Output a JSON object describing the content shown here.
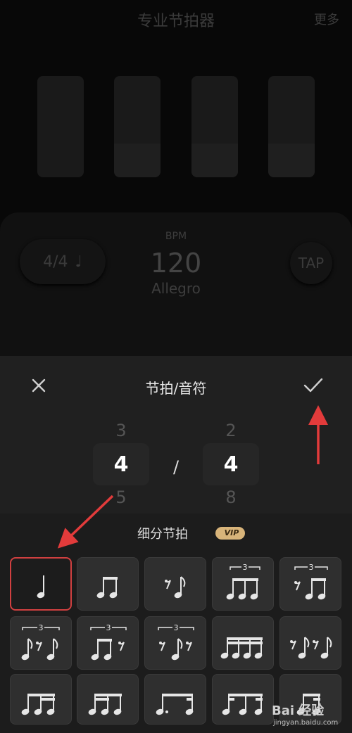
{
  "app": {
    "title": "专业节拍器",
    "more_label": "更多"
  },
  "metronome": {
    "time_signature": "4/4",
    "note_glyph": "♩",
    "bpm_label": "BPM",
    "bpm_value": "120",
    "tempo_name": "Allegro",
    "tap_label": "TAP",
    "beat_count": 4
  },
  "sheet": {
    "title": "节拍/音符",
    "beats_picker": {
      "above": "3",
      "selected": "4",
      "below": "5"
    },
    "separator": "/",
    "note_picker": {
      "above": "2",
      "selected": "4",
      "below": "8"
    },
    "subdivision_title": "细分节拍",
    "vip_badge": "VIP",
    "subdivisions": [
      {
        "name": "quarter",
        "selected": true
      },
      {
        "name": "two-eighths",
        "selected": false
      },
      {
        "name": "eighth-rest-eighth",
        "selected": false
      },
      {
        "name": "eighth-triplet",
        "selected": false
      },
      {
        "name": "triplet-rest-two-eighths",
        "selected": false
      },
      {
        "name": "triplet-eighth-rest-eighth",
        "selected": false
      },
      {
        "name": "triplet-two-eighths-rest",
        "selected": false
      },
      {
        "name": "triplet-rest-eighth-rest",
        "selected": false
      },
      {
        "name": "four-sixteenths",
        "selected": false
      },
      {
        "name": "sixteenth-rest-alternating",
        "selected": false
      },
      {
        "name": "eighth-two-sixteenths",
        "selected": false
      },
      {
        "name": "two-sixteenths-eighth",
        "selected": false
      },
      {
        "name": "dotted-eighth-sixteenth",
        "selected": false
      },
      {
        "name": "sixteenth-eighth-sixteenth",
        "selected": false
      },
      {
        "name": "more-pattern",
        "selected": false
      }
    ]
  },
  "colors": {
    "selected_border": "#d04040",
    "arrow": "#e23b3b",
    "vip_gold": "#d8b47a"
  },
  "watermark": {
    "brand": "Bai 经验",
    "url": "jingyan.baidu.com"
  }
}
